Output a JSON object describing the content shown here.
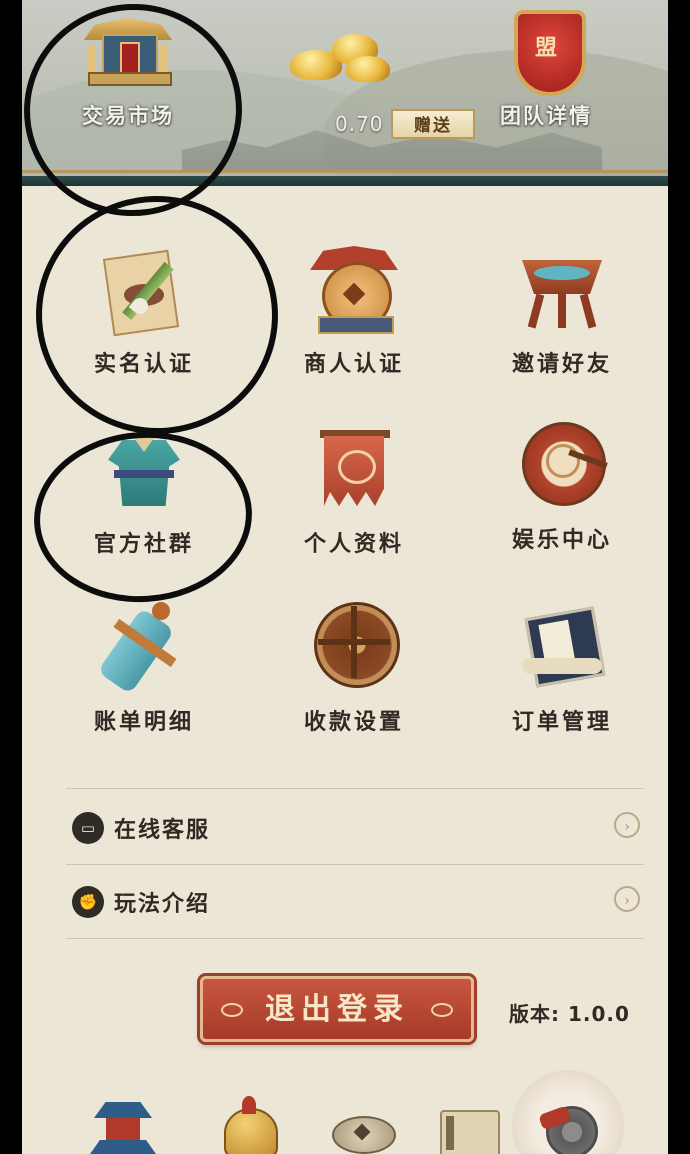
{
  "header": {
    "market_label": "交易市场",
    "gold_value": "0.70",
    "gift_label": "赠送",
    "team_label": "团队详情",
    "team_badge_char": "盟"
  },
  "grid": [
    {
      "label": "实名认证",
      "icon": "brush-scroll-icon"
    },
    {
      "label": "商人认证",
      "icon": "merchant-coin-icon"
    },
    {
      "label": "邀请好友",
      "icon": "wine-cup-icon"
    },
    {
      "label": "官方社群",
      "icon": "robe-icon"
    },
    {
      "label": "个人资料",
      "icon": "banner-icon"
    },
    {
      "label": "娱乐中心",
      "icon": "drum-icon"
    },
    {
      "label": "账单明细",
      "icon": "scroll-roll-icon"
    },
    {
      "label": "收款设置",
      "icon": "wheel-icon"
    },
    {
      "label": "订单管理",
      "icon": "book-icon"
    }
  ],
  "list": [
    {
      "label": "在线客服",
      "icon": "chat-icon"
    },
    {
      "label": "玩法介绍",
      "icon": "fist-icon"
    }
  ],
  "logout_label": "退出登录",
  "version_label": "版本: 1.0.0",
  "bottom_nav": [
    "pagoda-icon",
    "helmet-icon",
    "coin-icon",
    "scroll-icon",
    "gear-cannon-icon"
  ],
  "colors": {
    "page_bg": "#ece6d6",
    "logout_red": "#b4432f",
    "text_dark": "#2f2a24",
    "banner_teal": "#1d3535"
  }
}
